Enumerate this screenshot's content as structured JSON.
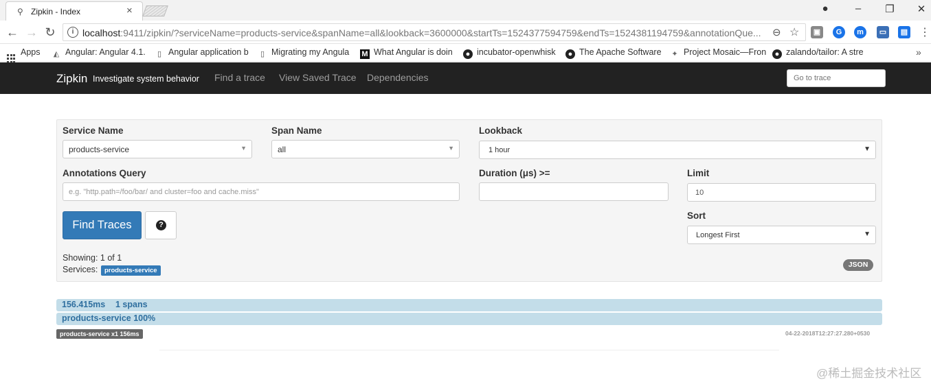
{
  "browser": {
    "tab_title": "Zipkin - Index",
    "url_host": "localhost",
    "url_rest": ":9411/zipkin/?serviceName=products-service&spanName=all&lookback=3600000&startTs=1524377594759&endTs=1524381194759&annotationQue...",
    "bookmarks": [
      {
        "label": "Apps",
        "icon": "apps-grid-icon"
      },
      {
        "label": "Angular: Angular 4.1.",
        "icon": "angular-icon"
      },
      {
        "label": "Angular application b",
        "icon": "page-icon"
      },
      {
        "label": "Migrating my Angula",
        "icon": "page-icon"
      },
      {
        "label": "What Angular is doin",
        "icon": "medium-icon"
      },
      {
        "label": "incubator-openwhisk",
        "icon": "github-icon"
      },
      {
        "label": "The Apache Software",
        "icon": "github-icon"
      },
      {
        "label": "Project Mosaic—Fron",
        "icon": "mosaic-icon"
      },
      {
        "label": "zalando/tailor: A stre",
        "icon": "github-icon"
      }
    ]
  },
  "navbar": {
    "brand": "Zipkin",
    "tagline": "Investigate system behavior",
    "links": [
      "Find a trace",
      "View Saved Trace",
      "Dependencies"
    ],
    "goto_placeholder": "Go to trace"
  },
  "search": {
    "service_name_label": "Service Name",
    "service_name_value": "products-service",
    "span_name_label": "Span Name",
    "span_name_value": "all",
    "lookback_label": "Lookback",
    "lookback_value": "1 hour",
    "annotations_label": "Annotations Query",
    "annotations_placeholder": "e.g. \"http.path=/foo/bar/ and cluster=foo and cache.miss\"",
    "duration_label": "Duration (μs) >=",
    "duration_value": "",
    "limit_label": "Limit",
    "limit_value": "10",
    "sort_label": "Sort",
    "sort_value": "Longest First",
    "find_button": "Find Traces",
    "help_glyph": "?",
    "json_button": "JSON"
  },
  "results": {
    "showing": "Showing: 1 of 1",
    "services_label": "Services:",
    "service_badge": "products-service",
    "trace": {
      "duration": "156.415ms",
      "spans": "1 spans",
      "service_pct": "products-service 100%",
      "service_summary": "products-service x1 156ms",
      "timestamp": "04-22-2018T12:27:27.280+0530"
    }
  },
  "watermark": "@稀土掘金技术社区"
}
